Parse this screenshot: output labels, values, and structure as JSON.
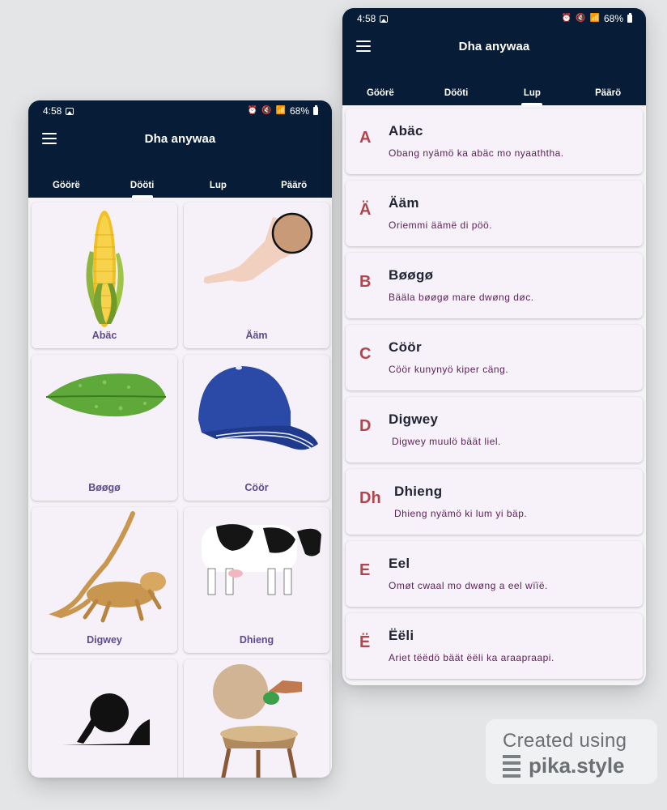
{
  "status": {
    "time": "4:58",
    "battery": "68%"
  },
  "app": {
    "title": "Dha anywaa",
    "tabs": [
      "Göörë",
      "Dööti",
      "Lup",
      "Päärö"
    ]
  },
  "left_screen": {
    "active_tab": "Dööti",
    "cards": [
      {
        "label": "Abäc",
        "icon": "corn-image"
      },
      {
        "label": "Ääm",
        "icon": "leg-image"
      },
      {
        "label": "Bøøgø",
        "icon": "leaf-image"
      },
      {
        "label": "Cöör",
        "icon": "cap-image"
      },
      {
        "label": "Digwey",
        "icon": "lizard-image"
      },
      {
        "label": "Dhieng",
        "icon": "cow-image"
      },
      {
        "label": "",
        "icon": "boulder-image"
      },
      {
        "label": "",
        "icon": "grinding-stone-image"
      }
    ]
  },
  "right_screen": {
    "active_tab": "Lup",
    "items": [
      {
        "letter": "A",
        "word": "Abäc",
        "sentence": "Obang nyämö ka abäc mo nyaaththa."
      },
      {
        "letter": "Ä",
        "word": "Ääm",
        "sentence": "Oriemmi äämë di pöö."
      },
      {
        "letter": "B",
        "word": "Bøøgø",
        "sentence": "Bääla bøøgø mare dwøng døc."
      },
      {
        "letter": "C",
        "word": "Cöör",
        "sentence": "Cöör kunynyö kiper cäng."
      },
      {
        "letter": "D",
        "word": "Digwey",
        "sentence": "Digwey muulö bäät liel."
      },
      {
        "letter": "Dh",
        "word": "Dhieng",
        "sentence": "Dhieng nyämö ki lum yi bäp."
      },
      {
        "letter": "E",
        "word": "Eel",
        "sentence": "Omøt cwaal mo dwøng a eel wïïë."
      },
      {
        "letter": "Ë",
        "word": "Ëëli",
        "sentence": "Ariet tëëdö bäät ëëli ka araapraapi."
      }
    ]
  },
  "watermark": {
    "line1": "Created using",
    "line2": "pika.style"
  },
  "colors": {
    "appbar": "#071c36",
    "letter": "#b0454b",
    "card_label": "#5d4a8f",
    "sentence": "#5a1f55"
  }
}
